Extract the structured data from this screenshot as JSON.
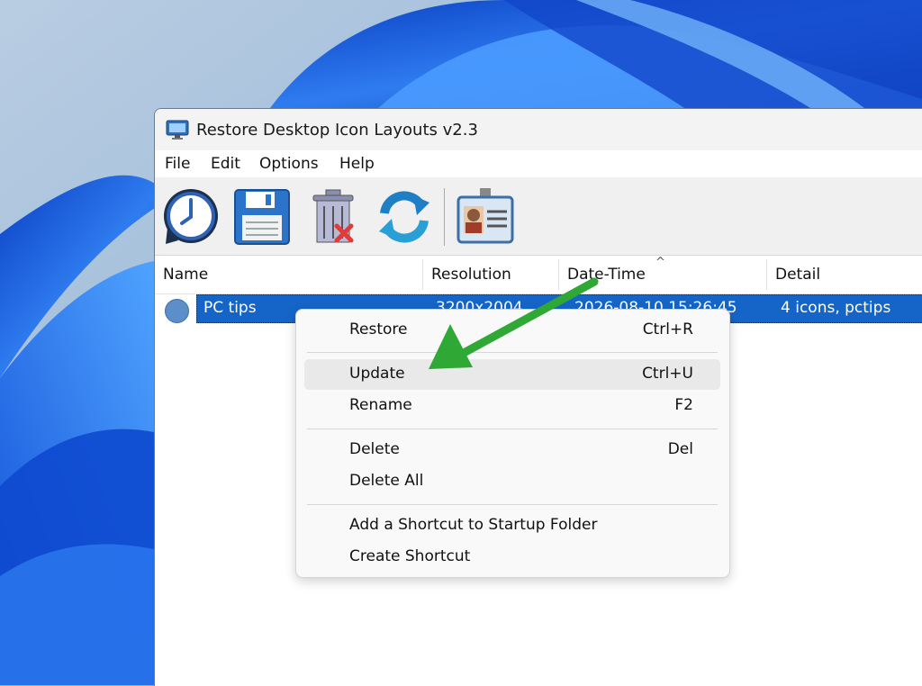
{
  "window": {
    "title": "Restore Desktop Icon Layouts v2.3"
  },
  "menu": [
    "File",
    "Edit",
    "Options",
    "Help"
  ],
  "toolbar": {
    "buttons": [
      {
        "icon": "restore-clock-icon"
      },
      {
        "icon": "save-floppy-icon"
      },
      {
        "icon": "delete-trash-icon"
      },
      {
        "icon": "refresh-icon"
      },
      {
        "icon": "id-card-icon"
      }
    ]
  },
  "list": {
    "columns": [
      "Name",
      "Resolution",
      "Date-Time",
      "Detail"
    ],
    "sort_indicator": "^",
    "rows": [
      {
        "name": "PC tips",
        "resolution": "3200x2004",
        "datetime": "2026-08-10 15:26:45",
        "detail": "4 icons, pctips"
      }
    ]
  },
  "context_menu": {
    "items": [
      {
        "label": "Restore",
        "shortcut": "Ctrl+R"
      },
      {
        "label": "Update",
        "shortcut": "Ctrl+U"
      },
      {
        "label": "Rename",
        "shortcut": "F2"
      },
      {
        "label": "Delete",
        "shortcut": "Del"
      },
      {
        "label": "Delete All",
        "shortcut": ""
      },
      {
        "label": "Add a Shortcut to Startup Folder",
        "shortcut": ""
      },
      {
        "label": "Create Shortcut",
        "shortcut": ""
      }
    ],
    "highlighted_item": "Update"
  },
  "colors": {
    "selection": "#1565c8",
    "annotation_arrow": "#2fa836",
    "wallpaper_blue": "#1a5fd6"
  }
}
